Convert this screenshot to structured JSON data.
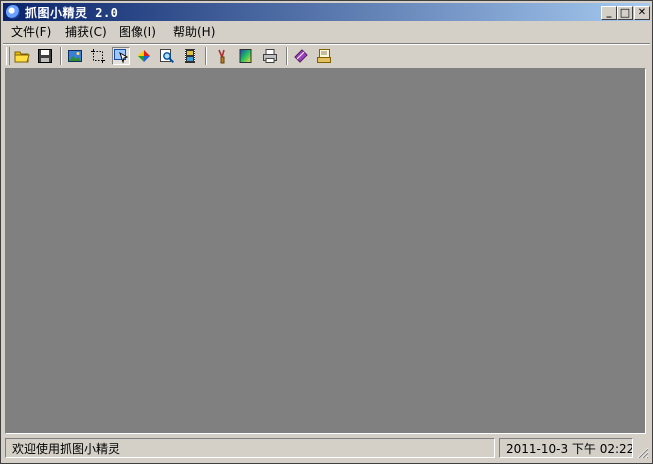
{
  "window": {
    "title": "抓图小精灵 2.0"
  },
  "caption_buttons": {
    "minimize": "_",
    "maximize": "□",
    "close": "✕"
  },
  "menu": [
    {
      "label": "文件(F)"
    },
    {
      "label": "捕获(C)"
    },
    {
      "label": "图像(I)"
    },
    {
      "label": "帮助(H)"
    }
  ],
  "toolbar": {
    "buttons": [
      {
        "icon": "open-folder-icon"
      },
      {
        "icon": "save-disk-icon"
      },
      {
        "icon": "image-icon"
      },
      {
        "icon": "crop-selection-icon"
      },
      {
        "icon": "capture-region-icon",
        "pressed": true
      },
      {
        "icon": "color-palette-icon"
      },
      {
        "icon": "zoom-magnifier-icon"
      },
      {
        "icon": "film-strip-icon"
      },
      {
        "icon": "brush-paint-icon"
      },
      {
        "icon": "gradient-image-icon"
      },
      {
        "icon": "printer-icon"
      },
      {
        "icon": "help-book-icon"
      },
      {
        "icon": "about-document-icon"
      }
    ]
  },
  "status": {
    "message": "欢迎使用抓图小精灵",
    "datetime": "2011-10-3 下午 02:22:"
  },
  "colors": {
    "title_start": "#0a246a",
    "title_end": "#a6caf0",
    "workspace": "#808080",
    "face": "#d4d0c8"
  }
}
